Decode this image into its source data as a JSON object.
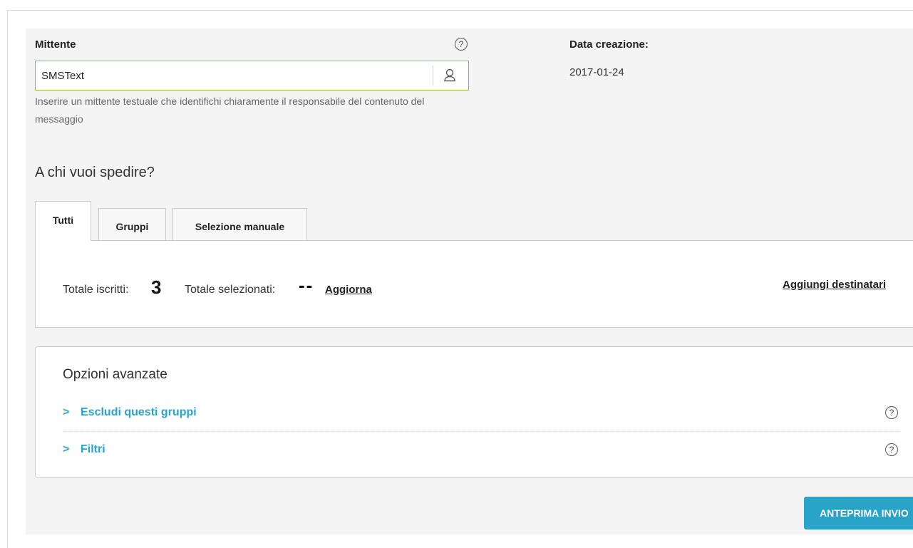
{
  "sender": {
    "label": "Mittente",
    "help": "?",
    "value": "SMSText",
    "placeholder": "",
    "hint": "Inserire un mittente testuale che identifichi chiaramente il responsabile del contenuto del messaggio"
  },
  "creation_date": {
    "label": "Data creazione:",
    "value": "2017-01-24"
  },
  "recipients": {
    "title": "A chi vuoi spedire?",
    "tabs": [
      {
        "label": "Tutti",
        "active": true
      },
      {
        "label": "Gruppi",
        "active": false
      },
      {
        "label": "Selezione manuale",
        "active": false
      }
    ],
    "total_subscribed_label": "Totale iscritti:",
    "total_subscribed_value": "3",
    "total_selected_label": "Totale selezionati:",
    "total_selected_value": "--",
    "refresh_link": "Aggiorna",
    "add_recipients_link": "Aggiungi destinatari"
  },
  "advanced": {
    "title": "Opzioni avanzate",
    "items": [
      {
        "label": "Escludi questi gruppi",
        "chevron": ">",
        "help": "?"
      },
      {
        "label": "Filtri",
        "chevron": ">",
        "help": "?"
      }
    ]
  },
  "actions": {
    "preview_label": "ANTEPRIMA INVIO"
  },
  "colors": {
    "accent": "#2aa3c9",
    "input_border": "#86c232",
    "background": "#f4f4f4"
  },
  "icons": {
    "sender_lookup": "user-icon",
    "help": "help-circle-icon",
    "expand": "chevron-right-icon"
  }
}
